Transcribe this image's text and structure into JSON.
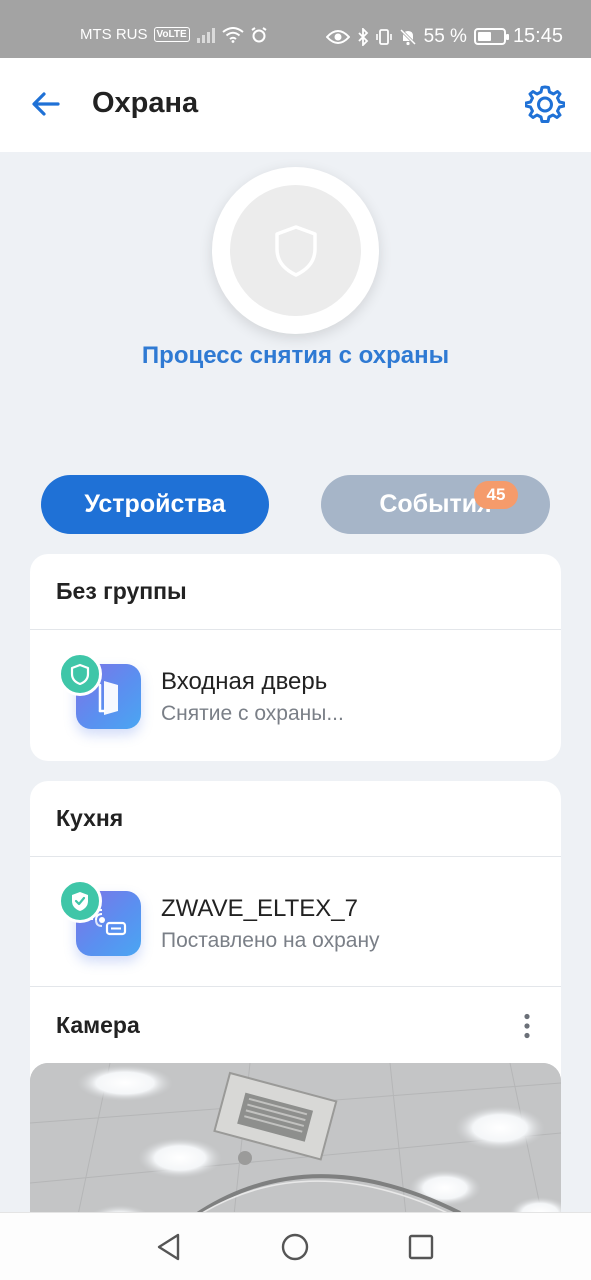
{
  "status_bar": {
    "carrier": "MTS RUS",
    "volte": "VoLTE",
    "battery_percent": "55 %",
    "battery_level": 0.55,
    "time": "15:45"
  },
  "header": {
    "title": "Охрана",
    "back_icon": "arrow-left-icon",
    "settings_icon": "gear-icon"
  },
  "security": {
    "status_text": "Процесс снятия с охраны",
    "icon": "shield-icon"
  },
  "tabs": {
    "devices_label": "Устройства",
    "events_label": "События",
    "events_badge": "45"
  },
  "groups": [
    {
      "name": "Без группы",
      "devices": [
        {
          "name": "Входная дверь",
          "status": "Снятие с охраны...",
          "icon": "door-icon"
        }
      ]
    },
    {
      "name": "Кухня",
      "devices": [
        {
          "name": "ZWAVE_ELTEX_7",
          "status": "Поставлено на охрану",
          "icon": "sensor-icon"
        }
      ]
    }
  ],
  "camera": {
    "label": "Камера"
  },
  "colors": {
    "accent": "#1f71d6",
    "link_blue": "#2f7ad3",
    "tab_inactive": "#a6b5c8",
    "badge": "#f59b6b",
    "shield_green": "#3fc6a8"
  }
}
